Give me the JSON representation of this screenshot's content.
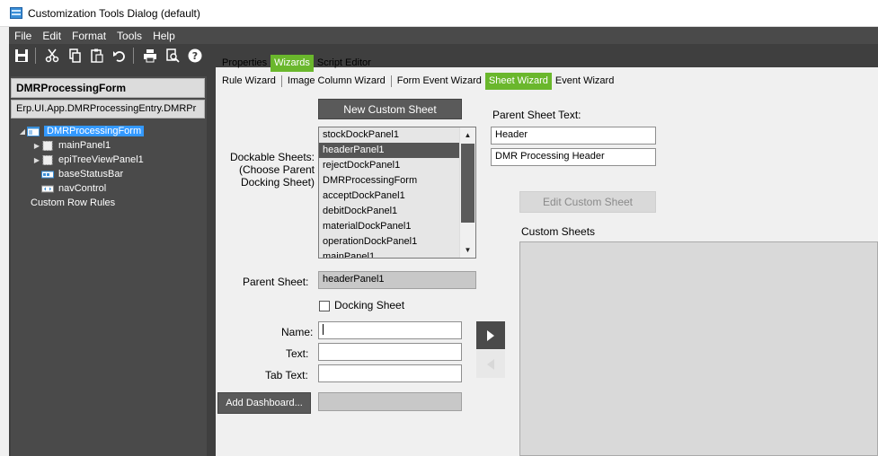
{
  "window": {
    "title": "Customization Tools Dialog (default)"
  },
  "menu": [
    "File",
    "Edit",
    "Format",
    "Tools",
    "Help"
  ],
  "left": {
    "form_name": "DMRProcessingForm",
    "form_path": "Erp.UI.App.DMRProcessingEntry.DMRPr",
    "tree": [
      {
        "label": "DMRProcessingForm",
        "selected": true,
        "icon": "form-icon"
      },
      {
        "label": "mainPanel1",
        "icon": "panel-icon"
      },
      {
        "label": "epiTreeViewPanel1",
        "icon": "panel-icon"
      },
      {
        "label": "baseStatusBar",
        "icon": "statusbar-icon"
      },
      {
        "label": "navControl",
        "icon": "navcontrol-icon"
      },
      {
        "label": "Custom Row Rules"
      }
    ]
  },
  "tabs_top": [
    {
      "label": "Properties"
    },
    {
      "label": "Wizards",
      "active": true
    },
    {
      "label": "Script Editor"
    }
  ],
  "tabs_wizards": [
    {
      "label": "Rule Wizard"
    },
    {
      "label": "Image Column Wizard"
    },
    {
      "label": "Form Event Wizard"
    },
    {
      "label": "Sheet Wizard",
      "active": true
    },
    {
      "label": "Event Wizard"
    }
  ],
  "sheet_wizard": {
    "new_sheet_button": "New Custom Sheet",
    "dockable_label": "Dockable Sheets:\n(Choose Parent\nDocking Sheet)",
    "dockable_sheets": [
      "stockDockPanel1",
      "headerPanel1",
      "rejectDockPanel1",
      "DMRProcessingForm",
      "acceptDockPanel1",
      "debitDockPanel1",
      "materialDockPanel1",
      "operationDockPanel1",
      "mainPanel1"
    ],
    "selected_sheet": "headerPanel1",
    "parent_sheet_text_label": "Parent Sheet Text:",
    "parent_sheet_text_1": "Header",
    "parent_sheet_text_2": "DMR Processing Header",
    "edit_sheet_button": "Edit Custom Sheet",
    "custom_sheets_label": "Custom Sheets",
    "parent_sheet_label": "Parent Sheet:",
    "parent_sheet_value": "headerPanel1",
    "docking_sheet_label": "Docking Sheet",
    "name_label": "Name:",
    "text_label": "Text:",
    "tab_text_label": "Tab Text:",
    "add_dashboard_button": "Add Dashboard..."
  },
  "colors": {
    "accent": "#6ab72c",
    "dark": "#4a4a4a",
    "selection": "#3399ff"
  }
}
